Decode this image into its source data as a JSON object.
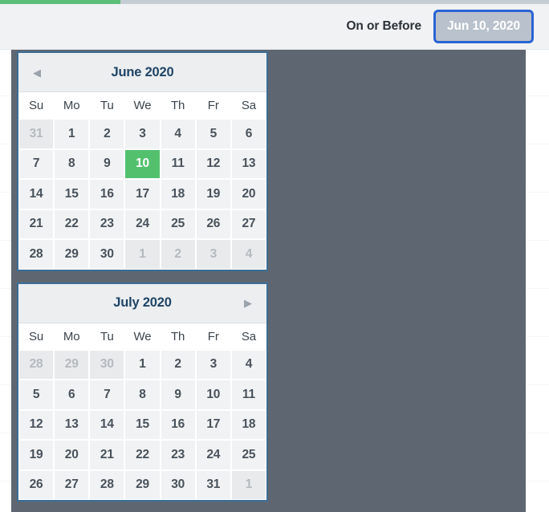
{
  "progress": {
    "percent": 22,
    "fill_color": "#5cbf77",
    "track_color": "#c4cdd4"
  },
  "toolbar": {
    "filter_label": "On or Before",
    "date_button_value": "Jun 10, 2020",
    "date_button_focus_color": "#2a64d4",
    "date_button_bg": "#b9c2cc"
  },
  "datepicker": {
    "weekday_labels": [
      "Su",
      "Mo",
      "Tu",
      "We",
      "Th",
      "Fr",
      "Sa"
    ],
    "selected_color": "#53c06e",
    "border_color": "#3b6e96",
    "months": [
      {
        "title": "June 2020",
        "prev_arrow": "◀",
        "next_arrow": "▶",
        "show_prev": true,
        "show_next": false,
        "weeks": [
          [
            {
              "d": "31",
              "muted": true,
              "selected": false
            },
            {
              "d": "1",
              "muted": false,
              "selected": false
            },
            {
              "d": "2",
              "muted": false,
              "selected": false
            },
            {
              "d": "3",
              "muted": false,
              "selected": false
            },
            {
              "d": "4",
              "muted": false,
              "selected": false
            },
            {
              "d": "5",
              "muted": false,
              "selected": false
            },
            {
              "d": "6",
              "muted": false,
              "selected": false
            }
          ],
          [
            {
              "d": "7",
              "muted": false,
              "selected": false
            },
            {
              "d": "8",
              "muted": false,
              "selected": false
            },
            {
              "d": "9",
              "muted": false,
              "selected": false
            },
            {
              "d": "10",
              "muted": false,
              "selected": true
            },
            {
              "d": "11",
              "muted": false,
              "selected": false
            },
            {
              "d": "12",
              "muted": false,
              "selected": false
            },
            {
              "d": "13",
              "muted": false,
              "selected": false
            }
          ],
          [
            {
              "d": "14",
              "muted": false,
              "selected": false
            },
            {
              "d": "15",
              "muted": false,
              "selected": false
            },
            {
              "d": "16",
              "muted": false,
              "selected": false
            },
            {
              "d": "17",
              "muted": false,
              "selected": false
            },
            {
              "d": "18",
              "muted": false,
              "selected": false
            },
            {
              "d": "19",
              "muted": false,
              "selected": false
            },
            {
              "d": "20",
              "muted": false,
              "selected": false
            }
          ],
          [
            {
              "d": "21",
              "muted": false,
              "selected": false
            },
            {
              "d": "22",
              "muted": false,
              "selected": false
            },
            {
              "d": "23",
              "muted": false,
              "selected": false
            },
            {
              "d": "24",
              "muted": false,
              "selected": false
            },
            {
              "d": "25",
              "muted": false,
              "selected": false
            },
            {
              "d": "26",
              "muted": false,
              "selected": false
            },
            {
              "d": "27",
              "muted": false,
              "selected": false
            }
          ],
          [
            {
              "d": "28",
              "muted": false,
              "selected": false
            },
            {
              "d": "29",
              "muted": false,
              "selected": false
            },
            {
              "d": "30",
              "muted": false,
              "selected": false
            },
            {
              "d": "1",
              "muted": true,
              "selected": false
            },
            {
              "d": "2",
              "muted": true,
              "selected": false
            },
            {
              "d": "3",
              "muted": true,
              "selected": false
            },
            {
              "d": "4",
              "muted": true,
              "selected": false
            }
          ]
        ]
      },
      {
        "title": "July 2020",
        "prev_arrow": "◀",
        "next_arrow": "▶",
        "show_prev": false,
        "show_next": true,
        "weeks": [
          [
            {
              "d": "28",
              "muted": true,
              "selected": false
            },
            {
              "d": "29",
              "muted": true,
              "selected": false
            },
            {
              "d": "30",
              "muted": true,
              "selected": false
            },
            {
              "d": "1",
              "muted": false,
              "selected": false
            },
            {
              "d": "2",
              "muted": false,
              "selected": false
            },
            {
              "d": "3",
              "muted": false,
              "selected": false
            },
            {
              "d": "4",
              "muted": false,
              "selected": false
            }
          ],
          [
            {
              "d": "5",
              "muted": false,
              "selected": false
            },
            {
              "d": "6",
              "muted": false,
              "selected": false
            },
            {
              "d": "7",
              "muted": false,
              "selected": false
            },
            {
              "d": "8",
              "muted": false,
              "selected": false
            },
            {
              "d": "9",
              "muted": false,
              "selected": false
            },
            {
              "d": "10",
              "muted": false,
              "selected": false
            },
            {
              "d": "11",
              "muted": false,
              "selected": false
            }
          ],
          [
            {
              "d": "12",
              "muted": false,
              "selected": false
            },
            {
              "d": "13",
              "muted": false,
              "selected": false
            },
            {
              "d": "14",
              "muted": false,
              "selected": false
            },
            {
              "d": "15",
              "muted": false,
              "selected": false
            },
            {
              "d": "16",
              "muted": false,
              "selected": false
            },
            {
              "d": "17",
              "muted": false,
              "selected": false
            },
            {
              "d": "18",
              "muted": false,
              "selected": false
            }
          ],
          [
            {
              "d": "19",
              "muted": false,
              "selected": false
            },
            {
              "d": "20",
              "muted": false,
              "selected": false
            },
            {
              "d": "21",
              "muted": false,
              "selected": false
            },
            {
              "d": "22",
              "muted": false,
              "selected": false
            },
            {
              "d": "23",
              "muted": false,
              "selected": false
            },
            {
              "d": "24",
              "muted": false,
              "selected": false
            },
            {
              "d": "25",
              "muted": false,
              "selected": false
            }
          ],
          [
            {
              "d": "26",
              "muted": false,
              "selected": false
            },
            {
              "d": "27",
              "muted": false,
              "selected": false
            },
            {
              "d": "28",
              "muted": false,
              "selected": false
            },
            {
              "d": "29",
              "muted": false,
              "selected": false
            },
            {
              "d": "30",
              "muted": false,
              "selected": false
            },
            {
              "d": "31",
              "muted": false,
              "selected": false
            },
            {
              "d": "1",
              "muted": true,
              "selected": false
            }
          ]
        ]
      }
    ]
  }
}
